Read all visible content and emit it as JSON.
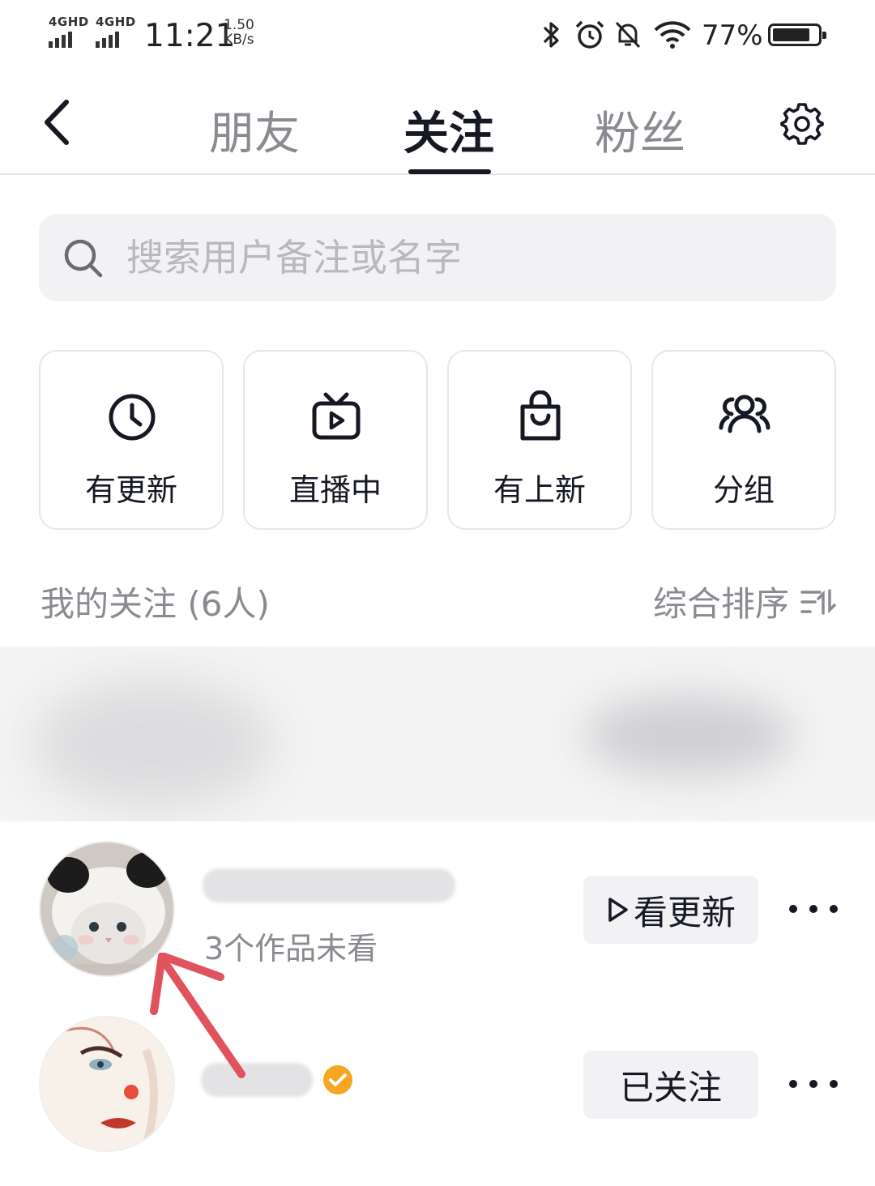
{
  "status_bar": {
    "net1_label": "4GHD",
    "net2_label": "4GHD",
    "time": "11:21",
    "speed_value": "1.50",
    "speed_unit": "KB/s",
    "battery_percent": "77%",
    "battery_level": 0.77,
    "icons": [
      "bluetooth-icon",
      "alarm-icon",
      "mute-bell-icon",
      "wifi-icon",
      "battery-icon"
    ]
  },
  "nav": {
    "tabs": [
      {
        "label": "朋友",
        "active": false
      },
      {
        "label": "关注",
        "active": true
      },
      {
        "label": "粉丝",
        "active": false
      }
    ]
  },
  "search": {
    "placeholder": "搜索用户备注或名字",
    "value": ""
  },
  "filters": [
    {
      "label": "有更新",
      "icon": "clock-icon"
    },
    {
      "label": "直播中",
      "icon": "tv-play-icon"
    },
    {
      "label": "有上新",
      "icon": "shopping-bag-icon"
    },
    {
      "label": "分组",
      "icon": "group-icon"
    }
  ],
  "list_header": {
    "title": "我的关注 (6人)",
    "sort_label": "综合排序"
  },
  "users": [
    {
      "subtitle": "3个作品未看",
      "action": "看更新",
      "verified": false
    },
    {
      "subtitle": "",
      "action": "已关注",
      "verified": true
    }
  ],
  "colors": {
    "primary_text": "#161823",
    "secondary_text": "#8a8b91",
    "button_bg": "#f2f2f4",
    "verified_badge": "#f5a623",
    "annotation_arrow": "#e0525c"
  }
}
